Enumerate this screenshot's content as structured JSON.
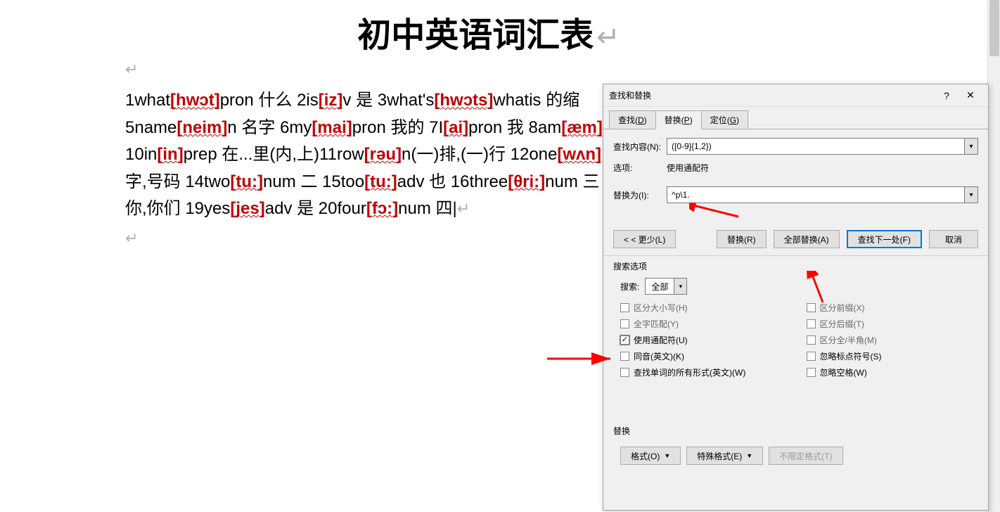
{
  "document": {
    "title": "初中英语词汇表",
    "lines": [
      [
        {
          "t": "1what",
          "c": ""
        },
        {
          "t": "[hwɔt]",
          "c": "phon"
        },
        {
          "t": "pron 什么 2is",
          "c": ""
        },
        {
          "t": "[iz]",
          "c": "phon"
        },
        {
          "t": "v 是 3what's",
          "c": ""
        },
        {
          "t": "[hwɔts]",
          "c": "phon"
        },
        {
          "t": "whatis 的缩",
          "c": ""
        }
      ],
      [
        {
          "t": "5name",
          "c": ""
        },
        {
          "t": "[neim]",
          "c": "phon"
        },
        {
          "t": "n 名字 6my",
          "c": ""
        },
        {
          "t": "[mai]",
          "c": "phon"
        },
        {
          "t": "pron 我的 7I",
          "c": ""
        },
        {
          "t": "[ai]",
          "c": "phon"
        },
        {
          "t": "pron 我 8am",
          "c": ""
        },
        {
          "t": "[æm]",
          "c": "phon"
        }
      ],
      [
        {
          "t": "10in",
          "c": ""
        },
        {
          "t": "[in]",
          "c": "phon"
        },
        {
          "t": "prep 在...里(内,上)11row",
          "c": ""
        },
        {
          "t": "[rəu]",
          "c": "phon"
        },
        {
          "t": "n(一)排,(一)行 12one",
          "c": ""
        },
        {
          "t": "[wʌn]",
          "c": "phon"
        }
      ],
      [
        {
          "t": "字,号码 14two",
          "c": ""
        },
        {
          "t": "[tu:]",
          "c": "phon"
        },
        {
          "t": "num 二 15too",
          "c": ""
        },
        {
          "t": "[tu:]",
          "c": "phon"
        },
        {
          "t": "adv 也 16three",
          "c": ""
        },
        {
          "t": "[θri:]",
          "c": "phon"
        },
        {
          "t": "num 三",
          "c": ""
        }
      ],
      [
        {
          "t": "你,你们 19yes",
          "c": ""
        },
        {
          "t": "[jes]",
          "c": "phon"
        },
        {
          "t": "adv 是 20four",
          "c": ""
        },
        {
          "t": "[fɔ:]",
          "c": "phon"
        },
        {
          "t": "num 四",
          "c": ""
        }
      ]
    ]
  },
  "dialog": {
    "title": "查找和替换",
    "help_symbol": "?",
    "close_symbol": "✕",
    "tabs": {
      "find": "查找(D)",
      "replace": "替换(P)",
      "goto": "定位(G)"
    },
    "find_label": "查找内容(N):",
    "find_value": "([0-9]{1,2})",
    "options_label": "选项:",
    "options_value": "使用通配符",
    "replace_label": "替换为(I):",
    "replace_value": "^p\\1.",
    "buttons": {
      "less": "< < 更少(L)",
      "replace": "替换(R)",
      "replace_all": "全部替换(A)",
      "find_next": "查找下一处(F)",
      "cancel": "取消"
    },
    "search_options_label": "搜索选项",
    "search_label": "搜索:",
    "search_scope": "全部",
    "checkboxes_left": [
      {
        "label": "区分大小写(H)",
        "checked": false,
        "enabled": false
      },
      {
        "label": "全字匹配(Y)",
        "checked": false,
        "enabled": false
      },
      {
        "label": "使用通配符(U)",
        "checked": true,
        "enabled": true,
        "highlight": true
      },
      {
        "label": "同音(英文)(K)",
        "checked": false,
        "enabled": true
      },
      {
        "label": "查找单词的所有形式(英文)(W)",
        "checked": false,
        "enabled": true
      }
    ],
    "checkboxes_right": [
      {
        "label": "区分前缀(X)",
        "checked": false,
        "enabled": false
      },
      {
        "label": "区分后缀(T)",
        "checked": false,
        "enabled": false
      },
      {
        "label": "区分全/半角(M)",
        "checked": false,
        "enabled": false
      },
      {
        "label": "忽略标点符号(S)",
        "checked": false,
        "enabled": true
      },
      {
        "label": "忽略空格(W)",
        "checked": false,
        "enabled": true
      }
    ],
    "replace_section_label": "替换",
    "format_buttons": {
      "format": "格式(O)",
      "special": "特殊格式(E)",
      "no_format": "不限定格式(T)"
    }
  }
}
